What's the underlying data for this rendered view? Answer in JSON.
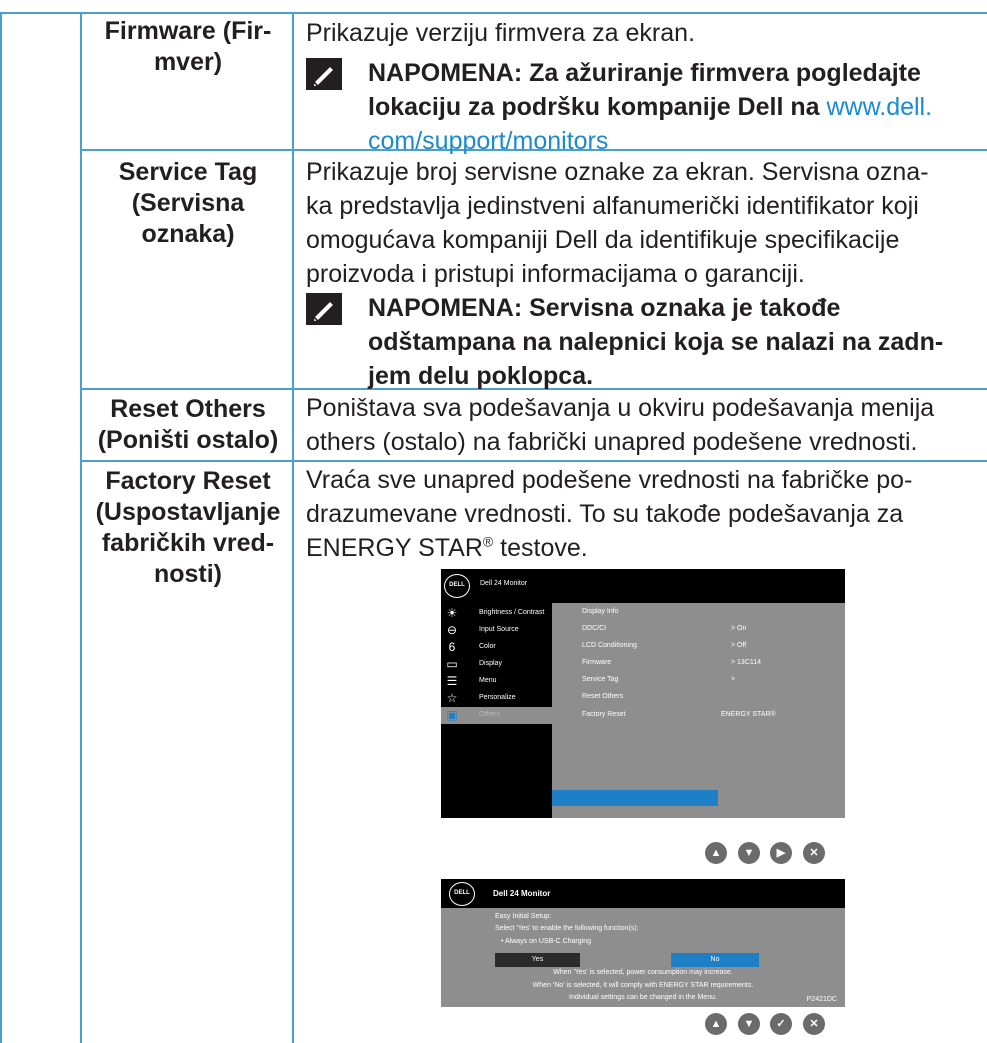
{
  "rows": [
    {
      "label": "Firmware (Fir-\nmver)",
      "text_lines": [
        "Prikazuje verziju firmvera za ekran."
      ],
      "note": {
        "lines": [
          "NAPOMENA: Za ažuriranje firmvera pogledajte",
          "lokaciju za podršku kompanije Dell na "
        ],
        "link_part1": "www.dell.",
        "link_part2": "com/support/monitors"
      }
    },
    {
      "label": "Service Tag\n(Servisna\noznaka)",
      "text_lines": [
        "Prikazuje broj servisne oznake za ekran. Servisna ozna-",
        "ka predstavlja jedinstveni alfanumerički identifikator koji",
        "omogućava kompaniji Dell da identifikuje specifikacije",
        "proizvoda i pristupi informacijama o garanciji."
      ],
      "note": {
        "lines": [
          "NAPOMENA: Servisna oznaka je takođe",
          "odštampana na nalepnici koja se nalazi na zadn-",
          "jem delu poklopca."
        ]
      }
    },
    {
      "label": "Reset Others\n(Poništi ostalo)",
      "text_lines": [
        "Poništava sva podešavanja u okviru podešavanja menija",
        "others (ostalo) na fabrički unapred podešene vrednosti."
      ]
    },
    {
      "label": "Factory Reset\n(Uspostavljanje\nfabričkih vred-\nnosti)",
      "text_lines": [
        "Vraća sve unapred podešene vrednosti na fabričke po-",
        "drazumevane vrednosti. To su takođe podešavanja za",
        "ENERGY STAR"
      ],
      "registered": "®",
      "text_tail": " testove."
    }
  ],
  "osd_menu": {
    "logo": "DELL",
    "title": "Dell 24 Monitor",
    "menu_items": [
      {
        "icon": "brightness-icon",
        "glyph": "☀",
        "label": "Brightness / Contrast"
      },
      {
        "icon": "input-source-icon",
        "glyph": "⊖",
        "label": "Input Source"
      },
      {
        "icon": "color-icon",
        "glyph": "6",
        "label": "Color"
      },
      {
        "icon": "display-icon",
        "glyph": "▭",
        "label": "Display"
      },
      {
        "icon": "menu-icon",
        "glyph": "☰",
        "label": "Menu"
      },
      {
        "icon": "personalize-icon",
        "glyph": "☆",
        "label": "Personalize"
      },
      {
        "icon": "others-icon",
        "glyph": "▣",
        "label": "Others"
      }
    ],
    "sub_items": [
      {
        "label": "Display Info",
        "value": ""
      },
      {
        "label": "DDC/CI",
        "value": ">   On"
      },
      {
        "label": "LCD Conditioning",
        "value": ">   Off"
      },
      {
        "label": "Firmware",
        "value": ">   13C114"
      },
      {
        "label": "Service Tag",
        "value": ">"
      },
      {
        "label": "Reset Others",
        "value": ""
      },
      {
        "label": "Factory Reset",
        "value": "ENERGY STAR®"
      }
    ]
  },
  "osd_dialog": {
    "logo": "DELL",
    "title": "Dell 24 Monitor",
    "line1": "Easy Initial Setup:",
    "line2": "Select 'Yes' to enable the following function(s):",
    "line3": "• Always on USB-C Charging",
    "yes": "Yes",
    "no": "No",
    "line4": "When 'Yes' is selected, power consumption may increase.",
    "line5": "When 'No' is selected, it will comply with ENERGY STAR requirements.",
    "line6": "Individual settings can be changed in the Menu.",
    "model": "P2421DC"
  },
  "nav_buttons_1": [
    "up-icon",
    "down-icon",
    "right-icon",
    "close-icon"
  ],
  "nav_buttons_2": [
    "up-icon",
    "down-icon",
    "check-icon",
    "close-icon"
  ],
  "colors": {
    "accent": "#4a9fcf",
    "link": "#1a8ad1",
    "highlight": "#1f7fc6"
  }
}
